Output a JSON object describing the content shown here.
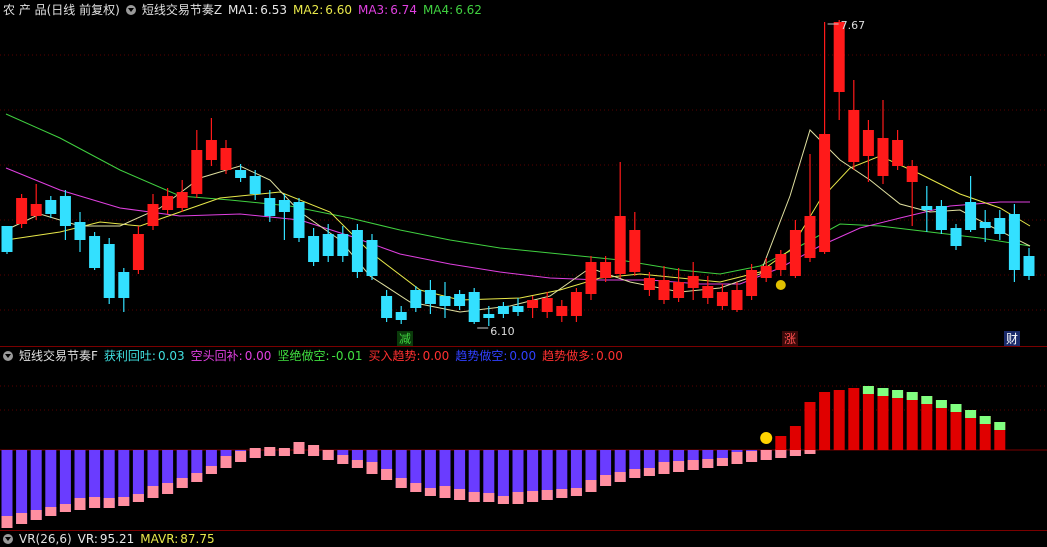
{
  "header": {
    "title": "农 产 品(日线 前复权)",
    "indicator": "短线交易节奏Z",
    "ma": [
      {
        "label": "MA1:",
        "value": "6.53",
        "color": "#e8e8e8"
      },
      {
        "label": "MA2:",
        "value": "6.60",
        "color": "#e8e84a"
      },
      {
        "label": "MA3:",
        "value": "6.74",
        "color": "#e040e0"
      },
      {
        "label": "MA4:",
        "value": "6.62",
        "color": "#40d040"
      }
    ]
  },
  "price_chart": {
    "high_label": "7.67",
    "low_label": "6.10",
    "markers": [
      {
        "text": "减",
        "color": "#40d040",
        "bg": "#0a3a0a"
      },
      {
        "text": "涨",
        "color": "#ff5050",
        "bg": "#3a0a0a"
      },
      {
        "text": "财",
        "color": "#ffffff",
        "bg": "#1a2a6a"
      }
    ],
    "colors": {
      "up": "#ff1a1a",
      "down": "#33e0ff"
    }
  },
  "indicator_bar": {
    "name": "短线交易节奏F",
    "items": [
      {
        "label": "获利回吐:",
        "value": "0.03",
        "color": "#40e0e0"
      },
      {
        "label": "空头回补:",
        "value": "0.00",
        "color": "#e040e0"
      },
      {
        "label": "坚绝做空:",
        "value": "-0.01",
        "color": "#40e040"
      },
      {
        "label": "买入趋势:",
        "value": "0.00",
        "color": "#ff3030"
      },
      {
        "label": "趋势做空:",
        "value": "0.00",
        "color": "#3040ff"
      },
      {
        "label": "趋势做多:",
        "value": "0.00",
        "color": "#ff3030"
      }
    ]
  },
  "vr_bar": {
    "name": "VR(26,6)",
    "items": [
      {
        "label": "VR:",
        "value": "95.21",
        "color": "#e8e8e8"
      },
      {
        "label": "MAVR:",
        "value": "87.75",
        "color": "#e8e84a"
      }
    ]
  }
}
